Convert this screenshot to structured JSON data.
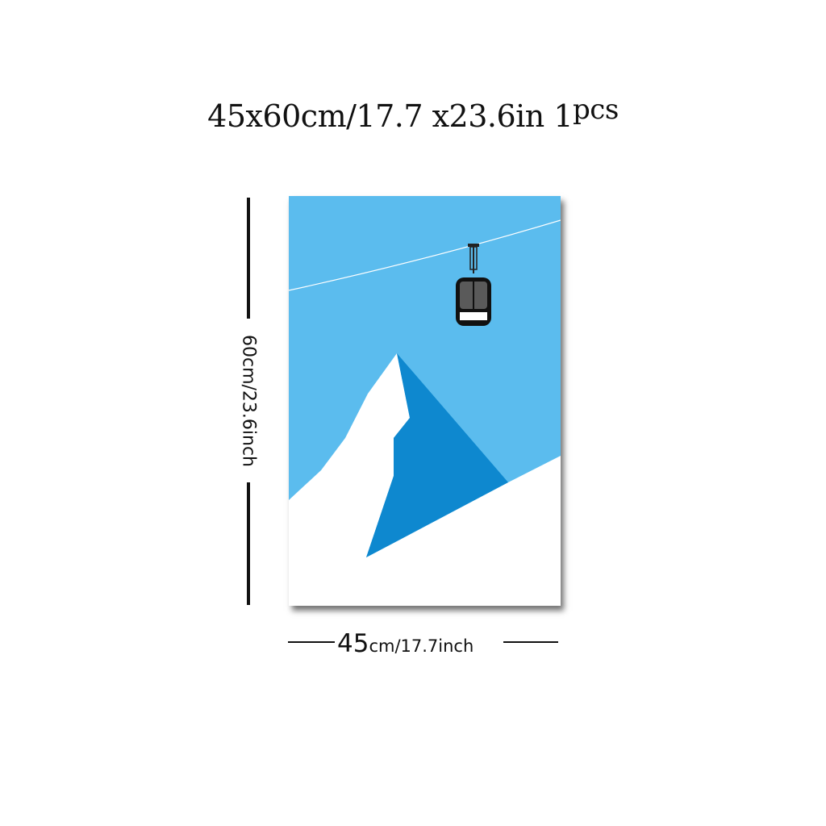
{
  "title": {
    "main": "45x60cm/17.7 x23.6in 1",
    "suffix": "pcs"
  },
  "dimensions": {
    "height_label": "60cm/23.6inch",
    "width_number": "45",
    "width_rest": "cm/17.7inch"
  },
  "artwork": {
    "subject": "cable car gondola over snowy mountain peak",
    "colors": {
      "sky": "#5bbcee",
      "mountain_shadow": "#0e88cf",
      "snow": "#ffffff",
      "cable": "#ffffff",
      "gondola_body": "#5a5a5a",
      "gondola_frame": "#111111"
    }
  }
}
